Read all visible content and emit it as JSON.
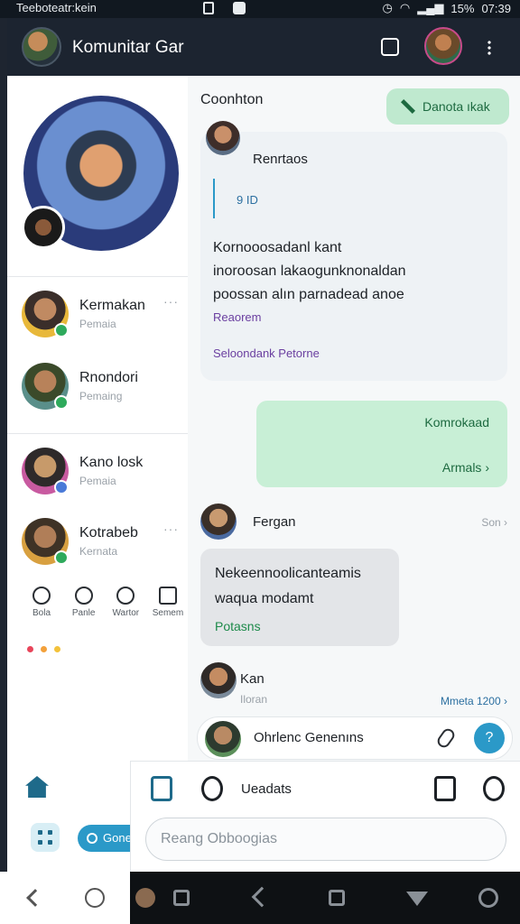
{
  "status_bar": {
    "carrier": "Teeboteatr:kein",
    "battery": "15%",
    "time": "07:39"
  },
  "left": {
    "app_title": "Komunitar Gar",
    "members": [
      {
        "name": "Kermakan",
        "role": "Pemaia",
        "more": "···"
      },
      {
        "name": "Rnondori",
        "role": "Pemaing",
        "more": ""
      },
      {
        "name": "Kano losk",
        "role": "Pemaia",
        "more": ""
      },
      {
        "name": "Kotrabeb",
        "role": "Kernata",
        "more": "···"
      }
    ],
    "actions": [
      {
        "label": "Bola"
      },
      {
        "label": "Panle"
      },
      {
        "label": "Wartor"
      },
      {
        "label": "Semem"
      }
    ],
    "dot_colors": [
      "#e8455a",
      "#f3a13b",
      "#f3c23b"
    ],
    "search_pill": "Gone"
  },
  "chat": {
    "header": "Coonhton",
    "action_button": "Danota ıkak",
    "card": {
      "sender": "Renrtaos",
      "quote": "9 ID",
      "body_lines": [
        "Kornooosadanl kant",
        "inoroosan lakaogunknonaldan",
        "poossan alın parnadead anoe"
      ],
      "link1": "Reaorem",
      "link2": "Seloondank Petorne"
    },
    "outgoing": {
      "title": "Komrokaad",
      "link": "Armals ›"
    },
    "sender2": {
      "name": "Fergan",
      "time": "Son ›"
    },
    "incoming": {
      "lines": [
        "Nekeennoolicanteamis",
        "waqua modamt"
      ],
      "link": "Potasns"
    },
    "sender3": {
      "name": "Kan",
      "sub": "Iloran",
      "time": "Mmeta 1200 ›"
    },
    "input_row": {
      "text": "Ohrlenc Genenıns",
      "fab": "?"
    }
  },
  "sheet": {
    "label": "Ueadats",
    "field_placeholder": "Reang Obboogias"
  }
}
